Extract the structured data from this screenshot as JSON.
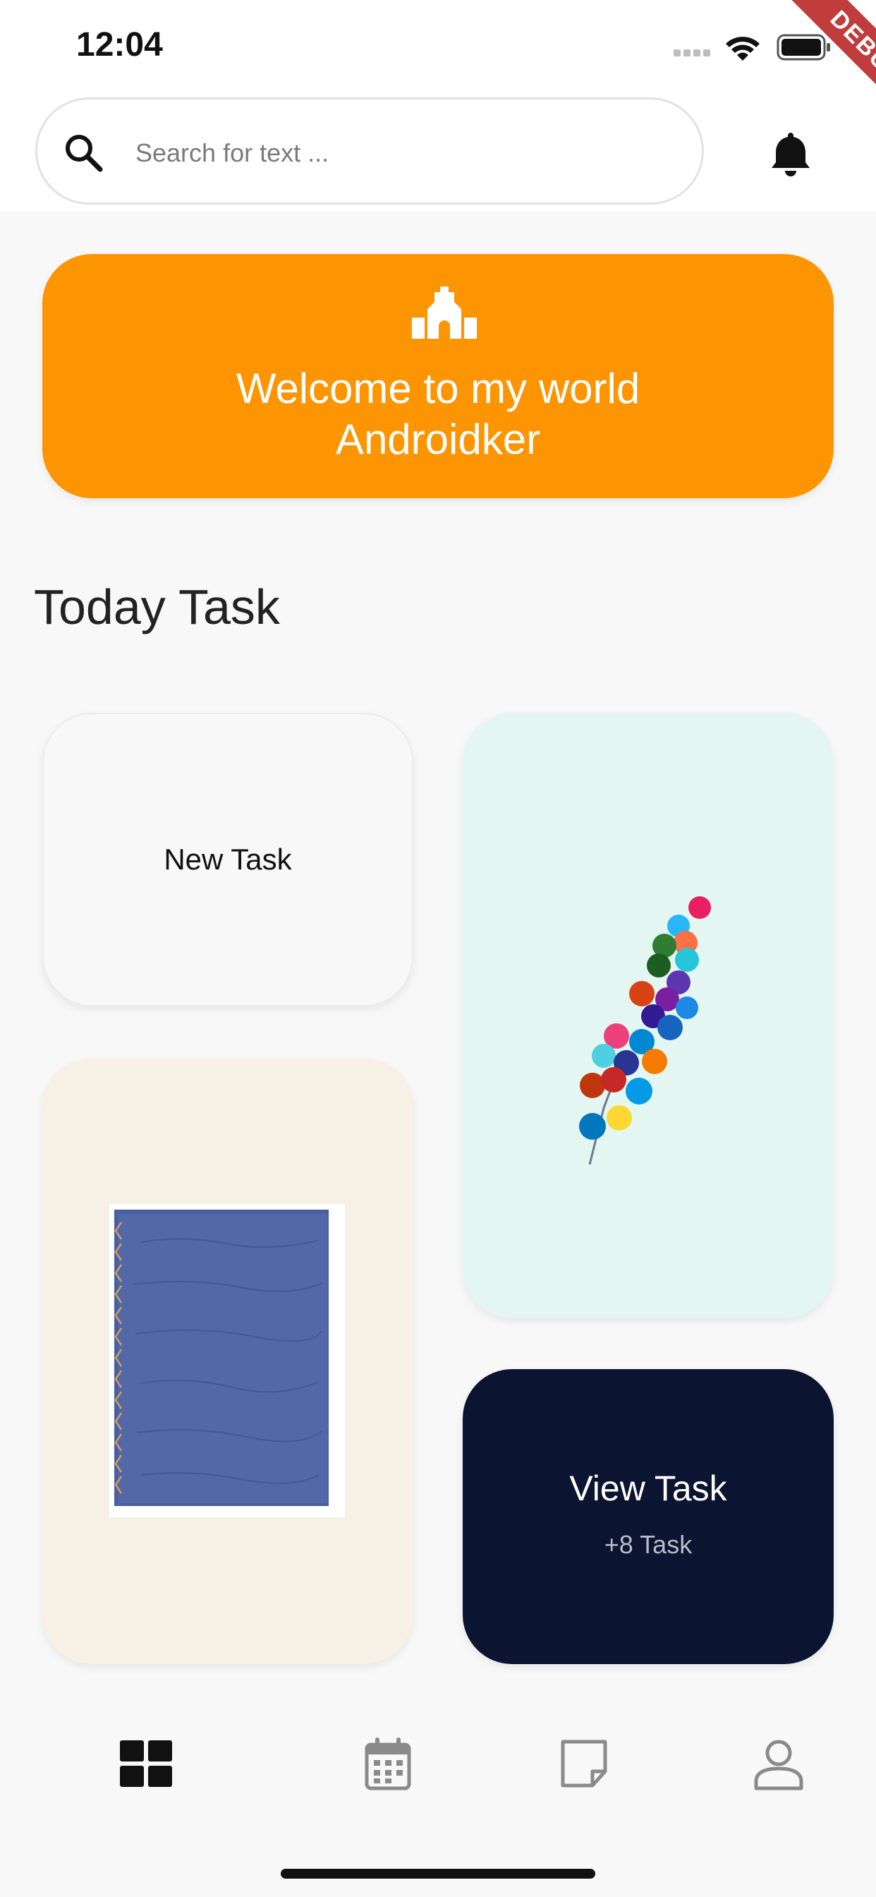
{
  "status_bar": {
    "time": "12:04",
    "debug_label": "DEBUG"
  },
  "search": {
    "placeholder": "Search for text ..."
  },
  "banner": {
    "line1": "Welcome to my world",
    "line2": "Androidker"
  },
  "section": {
    "title": "Today Task"
  },
  "cards": {
    "new_task": {
      "label": "New Task"
    },
    "view_task": {
      "label": "View Task",
      "count": "+8 Task"
    }
  },
  "bottom_nav": {
    "items": [
      {
        "icon": "dashboard-icon",
        "active": true
      },
      {
        "icon": "calendar-icon",
        "active": false
      },
      {
        "icon": "note-icon",
        "active": false
      },
      {
        "icon": "profile-icon",
        "active": false
      }
    ]
  },
  "colors": {
    "accent": "#fd9402",
    "dark_card": "#0b1430",
    "balloon_card": "#e4f6f1",
    "notebook_card": "#f6f0e5"
  }
}
